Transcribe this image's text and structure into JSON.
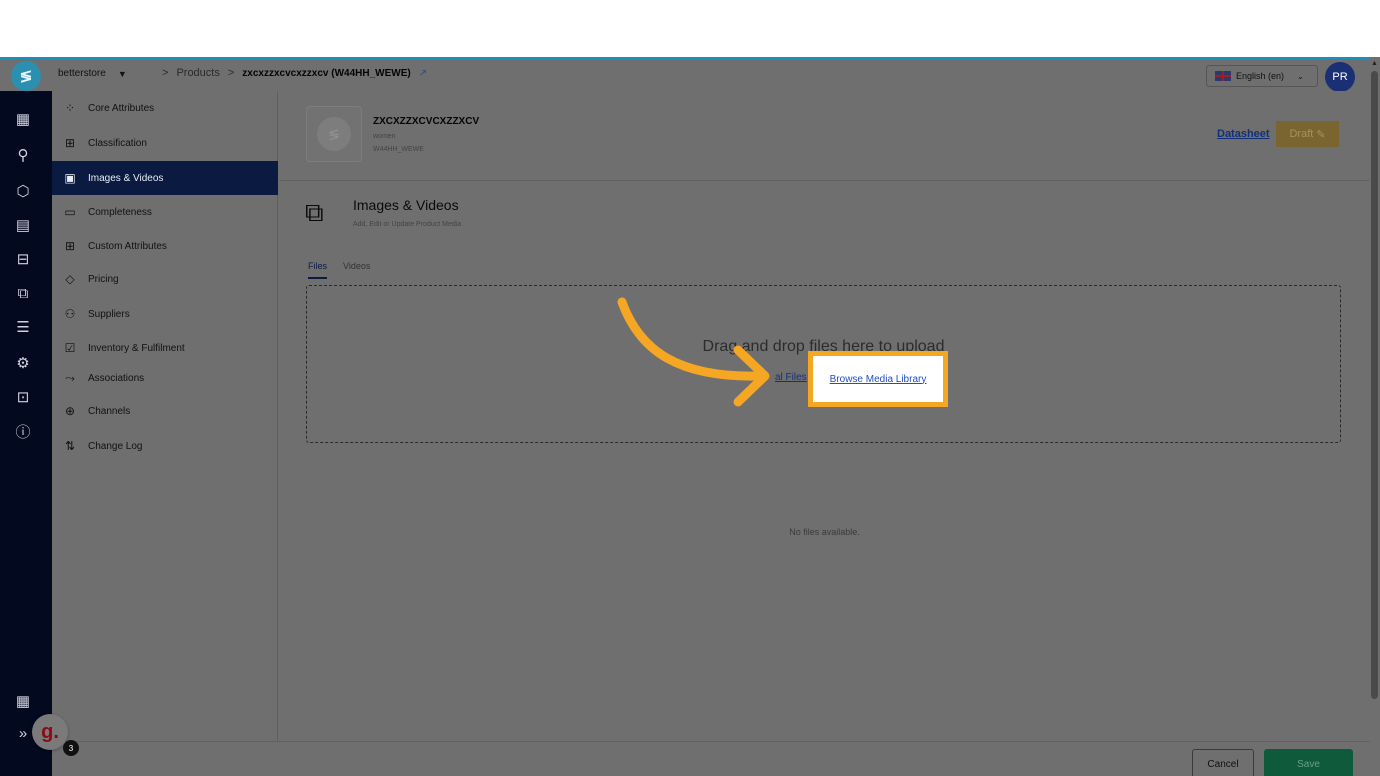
{
  "topbar": {
    "store": "betterstore",
    "crumb_products": "Products",
    "crumb_product": "zxcxzzxcvcxzzxcv (W44HH_WEWE)",
    "language": "English (en)",
    "avatar": "PR"
  },
  "menu": {
    "items": [
      {
        "label": "Core Attributes",
        "icon": "network-icon"
      },
      {
        "label": "Classification",
        "icon": "grid-icon"
      },
      {
        "label": "Images & Videos",
        "icon": "image-icon"
      },
      {
        "label": "Completeness",
        "icon": "battery-icon"
      },
      {
        "label": "Custom Attributes",
        "icon": "grid-plus-icon"
      },
      {
        "label": "Pricing",
        "icon": "tag-icon"
      },
      {
        "label": "Suppliers",
        "icon": "user-icon"
      },
      {
        "label": "Inventory & Fulfilment",
        "icon": "box-check-icon"
      },
      {
        "label": "Associations",
        "icon": "branch-icon"
      },
      {
        "label": "Channels",
        "icon": "channels-icon"
      },
      {
        "label": "Change Log",
        "icon": "sort-icon"
      }
    ]
  },
  "product": {
    "name": "ZXCXZZXCVCXZZXCV",
    "category": "women",
    "sku": "W44HH_WEWE",
    "datasheet": "Datasheet",
    "status": "Draft"
  },
  "section": {
    "title": "Images & Videos",
    "subtitle": "Add, Edit or Update Product Media",
    "tabs": [
      "Files",
      "Videos"
    ],
    "drop_text": "Drag and drop files here to upload",
    "local_files": "al Files",
    "browse": "Browse Media Library",
    "empty": "No files available."
  },
  "footer": {
    "cancel": "Cancel",
    "save": "Save"
  },
  "widget": {
    "letter": "g.",
    "count": "3"
  },
  "colors": {
    "accent": "#f5a623",
    "rail": "#03091f",
    "active": "#0a1a40"
  }
}
